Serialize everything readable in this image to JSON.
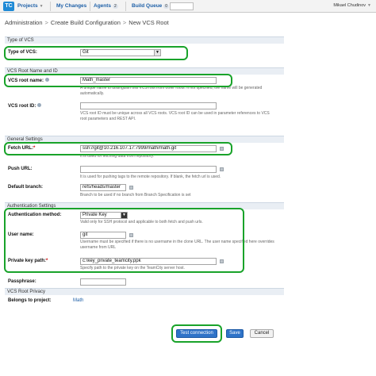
{
  "topbar": {
    "logo": "TC",
    "projects": "Projects",
    "my_changes": "My Changes",
    "agents": "Agents",
    "agents_count": "2",
    "build_queue": "Build Queue",
    "build_queue_count": "0",
    "user": "Mikael Chudinov"
  },
  "breadcrumb": {
    "item1": "Administration",
    "item2": "Create Build Configuration",
    "item3": "New VCS Root",
    "separator": ">"
  },
  "sections": {
    "type_of_vcs": "Type of VCS",
    "root_name_and_id": "VCS Root Name and ID",
    "general_settings": "General Settings",
    "auth_settings": "Authentication Settings",
    "vcs_root_privacy": "VCS Root Privacy"
  },
  "form": {
    "type_of_vcs_label": "Type of VCS:",
    "type_of_vcs_value": "Git",
    "root_name_label": "VCS root name:",
    "root_name_value": "Math_master",
    "root_name_hint1": "A unique name to distinguish this VCS root from other roots. If not specified, the name will be generated",
    "root_name_hint2": "automatically.",
    "root_id_label": "VCS root ID:",
    "root_id_value": "",
    "root_id_hint1": "VCS root ID must be unique across all VCS roots. VCS root ID can be used in parameter references to VCS",
    "root_id_hint2": "root parameters and REST API.",
    "fetch_url_label": "Fetch URL:",
    "fetch_url_value": "ssh://git@10.216.107.17:7999/math/math.git",
    "fetch_url_hint": "It is used for fetching data from repository.",
    "push_url_label": "Push URL:",
    "push_url_value": "",
    "push_url_hint": "It is used for pushing tags to the remote repository. If blank, the fetch url is used.",
    "default_branch_label": "Default branch:",
    "default_branch_value": "refs/heads/master",
    "default_branch_hint": "Branch to be used if no branch from Branch Specification is set",
    "auth_method_label": "Authentication method:",
    "auth_method_value": "Private Key",
    "auth_method_hint": "Valid only for SSH protocol and applicable to both fetch and push urls.",
    "username_label": "User name:",
    "username_value": "git",
    "username_hint1": "Username must be specified if there is no username in the clone URL. The user name specified here overrides",
    "username_hint2": "username from URL",
    "private_key_label": "Private key path:",
    "private_key_value": "c:\\key_private_teamcity.ppk",
    "private_key_hint": "Specify path to the private key on the TeamCity server host.",
    "passphrase_label": "Passphrase:",
    "passphrase_value": "",
    "belongs_label": "Belongs to project:",
    "belongs_value": "Math"
  },
  "buttons": {
    "test_connection": "Test connection",
    "save": "Save",
    "cancel": "Cancel"
  },
  "colors": {
    "highlight": "#19a32a",
    "primary_button": "#2f73c8",
    "link": "#1d5fa7"
  }
}
